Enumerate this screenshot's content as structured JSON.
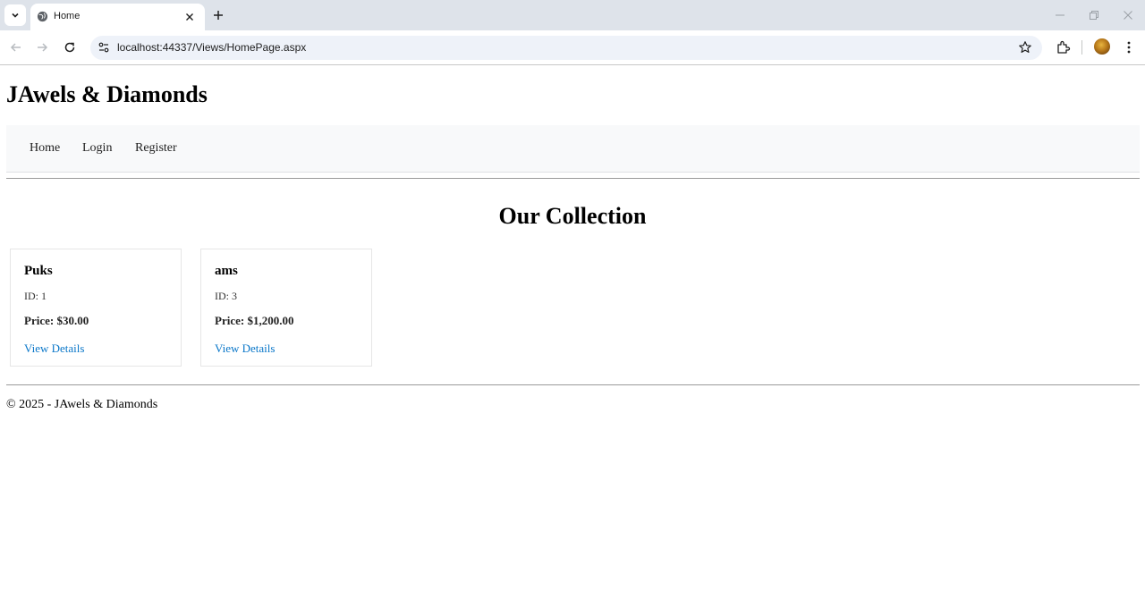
{
  "browser": {
    "tab_title": "Home",
    "url": "localhost:44337/Views/HomePage.aspx"
  },
  "site": {
    "title": "JAwels & Diamonds",
    "nav": [
      "Home",
      "Login",
      "Register"
    ]
  },
  "collection": {
    "heading": "Our Collection",
    "items": [
      {
        "name": "Puks",
        "id": "ID: 1",
        "price": "Price: $30.00",
        "link": "View Details"
      },
      {
        "name": "ams",
        "id": "ID: 3",
        "price": "Price: $1,200.00",
        "link": "View Details"
      }
    ]
  },
  "footer": {
    "text": "© 2025 - JAwels & Diamonds"
  }
}
